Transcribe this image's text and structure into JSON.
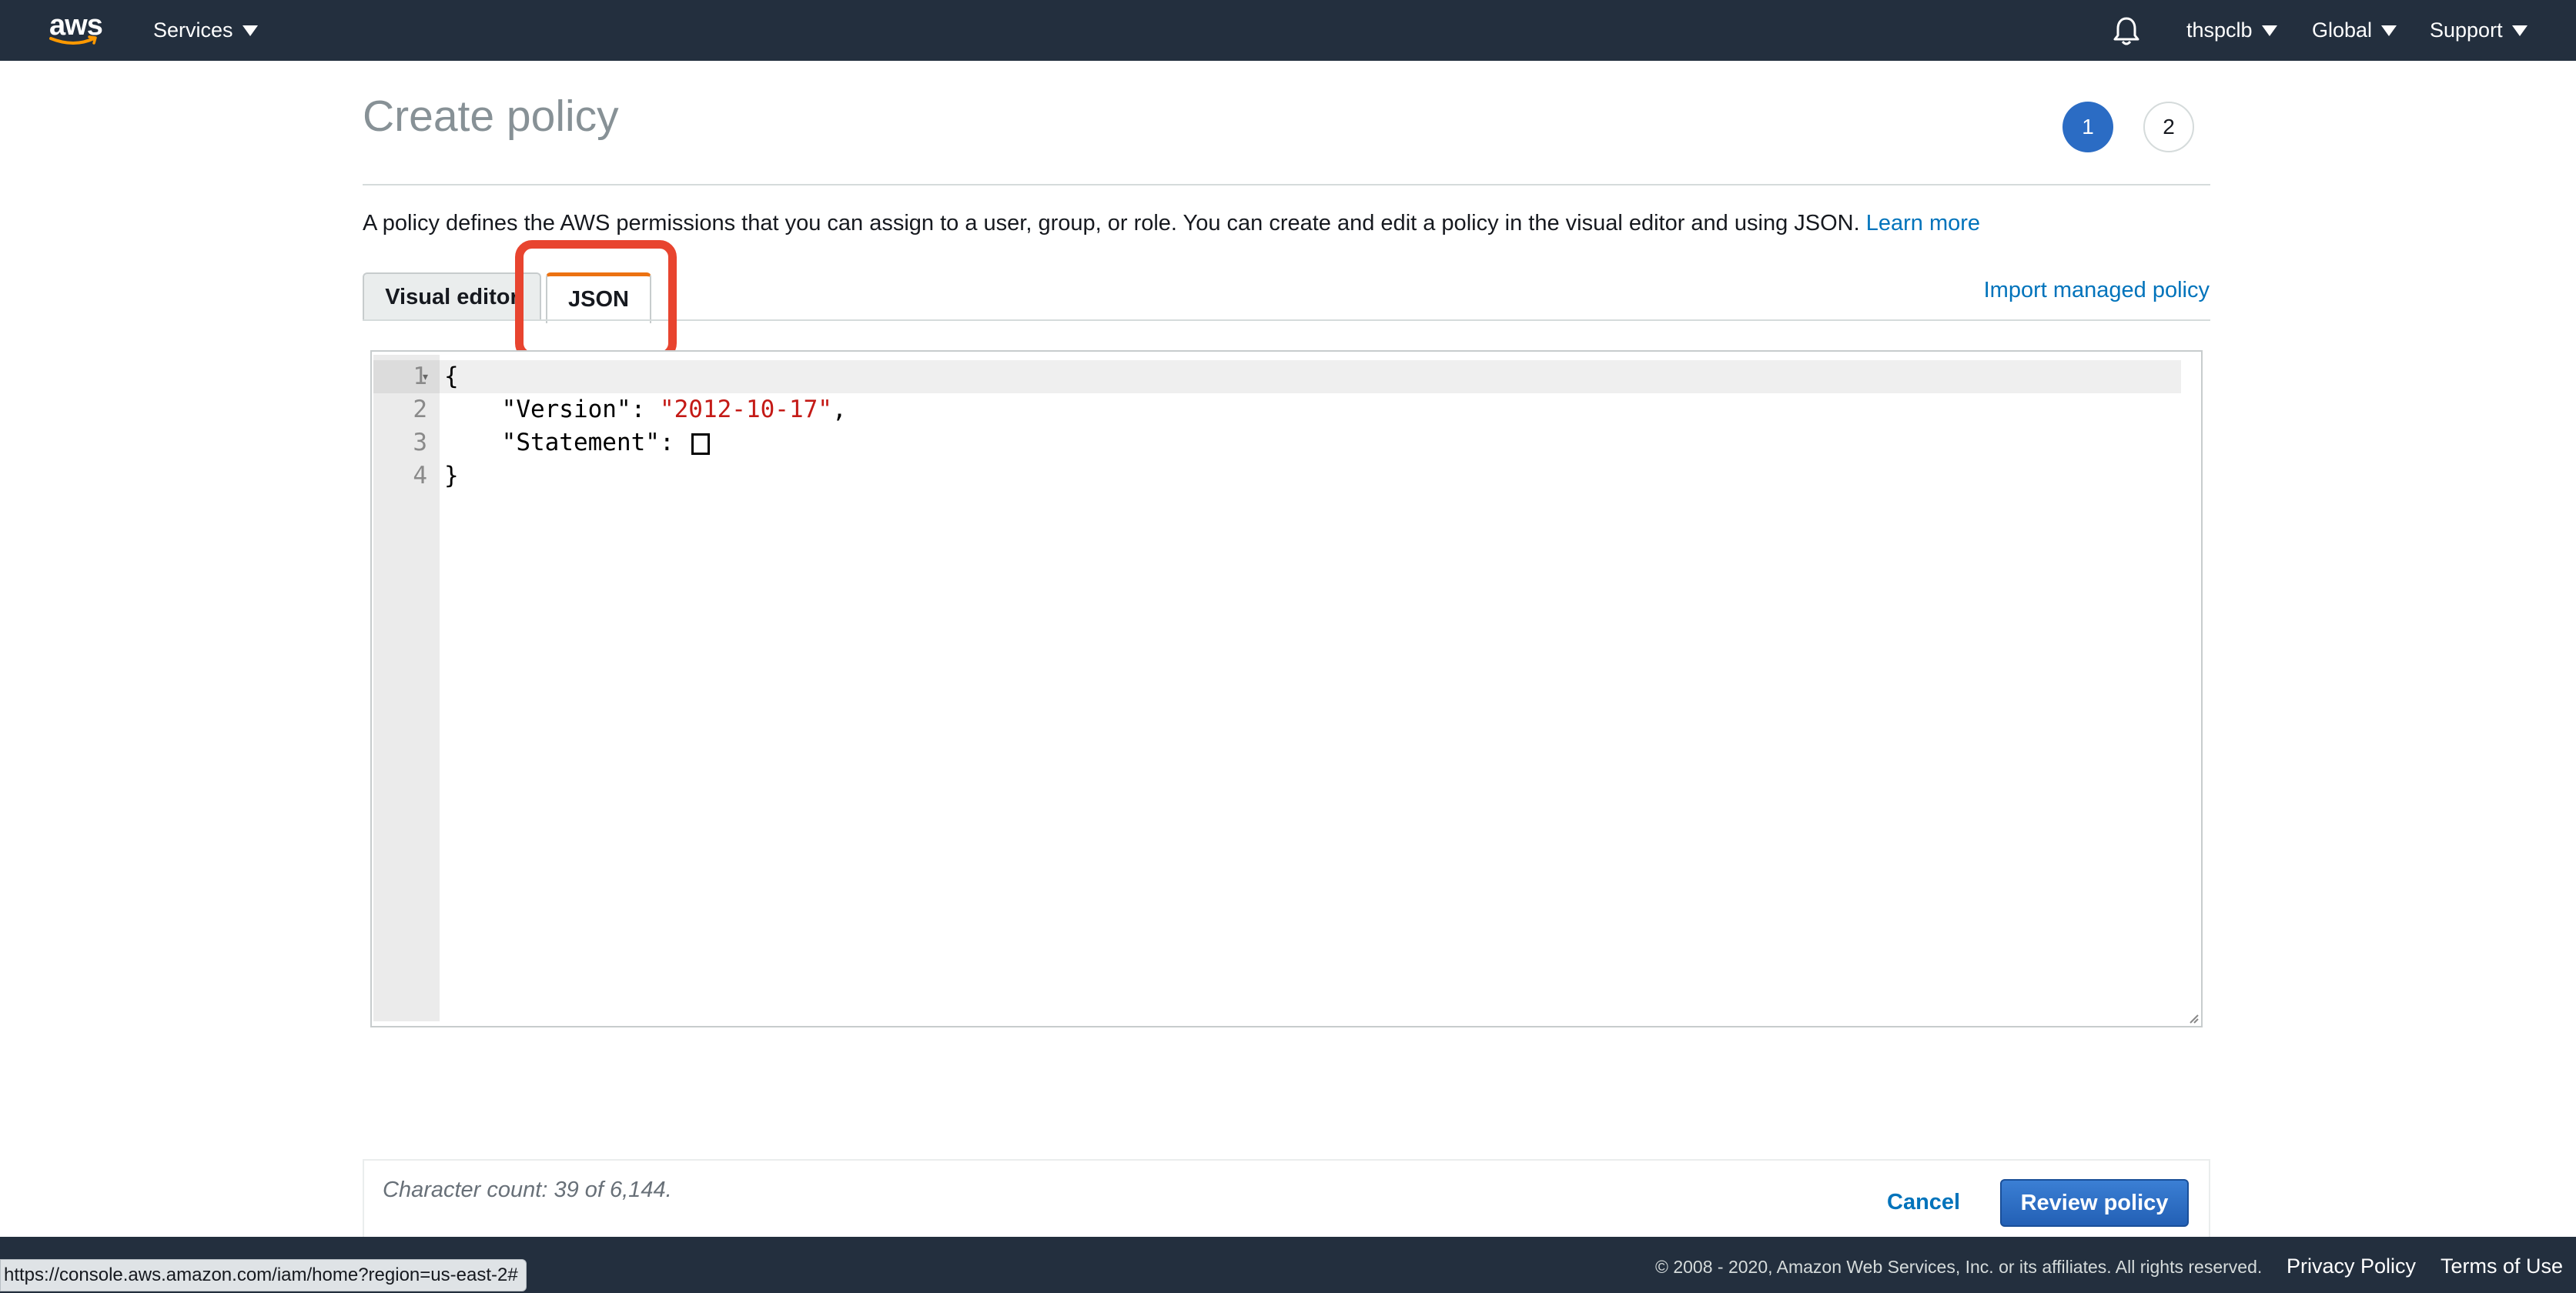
{
  "nav": {
    "logo_text": "aws",
    "services": "Services",
    "account": "thspclb",
    "region": "Global",
    "support": "Support",
    "bell_icon": "bell-icon"
  },
  "page": {
    "title": "Create policy",
    "steps": [
      "1",
      "2"
    ],
    "current_step": 1,
    "description": "A policy defines the AWS permissions that you can assign to a user, group, or role. You can create and edit a policy in the visual editor and using JSON.",
    "learn_more": "Learn more"
  },
  "tabs": {
    "visual_editor": "Visual editor",
    "json": "JSON",
    "active": "JSON",
    "import_link": "Import managed policy"
  },
  "editor": {
    "line_numbers": [
      "1",
      "2",
      "3",
      "4"
    ],
    "lines": {
      "l1": "{",
      "l2_key": "    \"Version\": ",
      "l2_val": "\"2012-10-17\"",
      "l2_end": ",",
      "l3_key": "    \"Statement\": ",
      "l4": "}"
    }
  },
  "bottom": {
    "char_count": "Character count: 39 of 6,144.",
    "cancel": "Cancel",
    "review": "Review policy"
  },
  "footer": {
    "copyright": "© 2008 - 2020, Amazon Web Services, Inc. or its affiliates. All rights reserved.",
    "privacy": "Privacy Policy",
    "terms": "Terms of Use",
    "status_url": "https://console.aws.amazon.com/iam/home?region=us-east-2#"
  },
  "colors": {
    "nav_bg": "#232f3e",
    "link": "#0073bb",
    "active_tab_accent": "#ec7211",
    "highlight": "#e8442f",
    "primary_button": "#2b6cc4"
  }
}
